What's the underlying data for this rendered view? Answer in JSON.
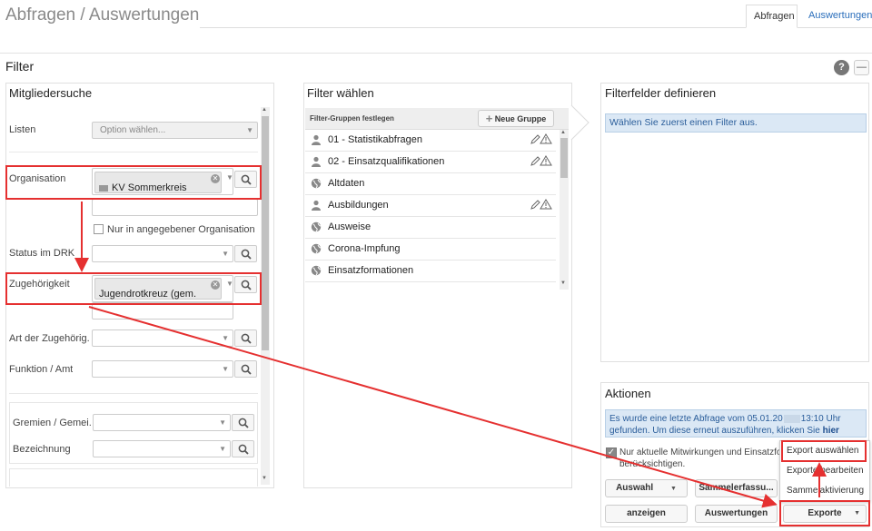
{
  "page": {
    "title": "Abfragen / Auswertungen",
    "tabs": [
      {
        "label": "Abfragen",
        "active": true
      },
      {
        "label": "Auswertungen",
        "active": false
      }
    ],
    "filter_heading": "Filter",
    "help_icon": "?",
    "collapse_icon": "—"
  },
  "member_search": {
    "heading": "Mitgliedersuche",
    "listen": {
      "label": "Listen",
      "placeholder": "Option wählen..."
    },
    "organisation": {
      "label": "Organisation",
      "selected": "KV Sommerkreis"
    },
    "only_org_checkbox": {
      "label": "Nur in angegebener Organisation s..."
    },
    "status": {
      "label": "Status im DRK"
    },
    "zugehoerigkeit": {
      "label": "Zugehörigkeit",
      "selected": "Jugendrotkreuz (gem. Ordnung)"
    },
    "art": {
      "label": "Art der Zugehörig..."
    },
    "funktion": {
      "label": "Funktion / Amt"
    },
    "gremien": {
      "label": "Gremien / Gemei..."
    },
    "bezeichnung": {
      "label": "Bezeichnung"
    }
  },
  "filter_select": {
    "heading": "Filter wählen",
    "groups_label": "Filter-Gruppen festlegen",
    "new_group_button": "Neue Gruppe",
    "items": [
      {
        "label": "01 - Statistikabfragen",
        "icon": "person-icon",
        "editable": true
      },
      {
        "label": "02 - Einsatzqualifikationen",
        "icon": "person-icon",
        "editable": true
      },
      {
        "label": "Altdaten",
        "icon": "globe-icon",
        "editable": false
      },
      {
        "label": "Ausbildungen",
        "icon": "person-icon",
        "editable": true
      },
      {
        "label": "Ausweise",
        "icon": "globe-icon",
        "editable": false
      },
      {
        "label": "Corona-Impfung",
        "icon": "globe-icon",
        "editable": false
      },
      {
        "label": "Einsatzformationen",
        "icon": "globe-icon",
        "editable": false
      }
    ]
  },
  "filter_fields": {
    "heading": "Filterfelder definieren",
    "info": "Wählen Sie zuerst einen Filter aus."
  },
  "actions": {
    "heading": "Aktionen",
    "info_line1": "Es wurde eine letzte Abfrage vom 05.01.20",
    "info_time": "13:10 Uhr",
    "info_line2": "gefunden. Um diese erneut auszuführen, klicken Sie",
    "info_link": "hier",
    "checkbox_line1": "Nur aktuelle Mitwirkungen und Einsatzforr",
    "checkbox_line2": "berücksichtigen.",
    "buttons": {
      "auswahl": "Auswahl",
      "sammelerfassung": "Sammelerfassu...",
      "anzeigen": "anzeigen",
      "auswertungen": "Auswertungen",
      "exporte": "Exporte"
    },
    "export_menu": [
      "Export auswählen",
      "Exporte bearbeiten",
      "Sammelaktivierung"
    ]
  },
  "colors": {
    "accent_link": "#2a6ebb",
    "highlight_red": "#e53030",
    "info_bg": "#dbe8f5"
  }
}
